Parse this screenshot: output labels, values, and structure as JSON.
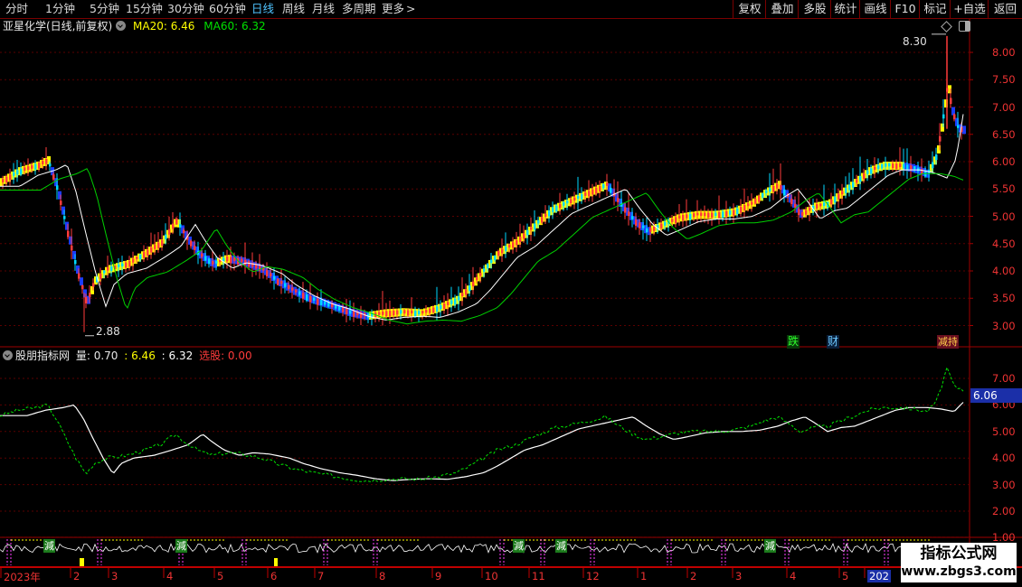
{
  "toolbar": {
    "periods": [
      "分时",
      "1分钟",
      "5分钟",
      "15分钟",
      "30分钟",
      "60分钟",
      "日线",
      "周线",
      "月线",
      "多周期",
      "更多"
    ],
    "active_period": "日线",
    "more_arrow": ">",
    "right_buttons": [
      "复权",
      "叠加",
      "多股",
      "统计",
      "画线",
      "F10",
      "标记",
      "+自选",
      "返回"
    ]
  },
  "main_panel": {
    "stock_title": "亚星化学(日线,前复权)",
    "ma20_label": "MA20: 6.46",
    "ma60_label": "MA60: 6.32",
    "high_marker": "8.30",
    "low_marker": "2.88",
    "y_ticks": [
      "8.00",
      "7.50",
      "7.00",
      "6.50",
      "6.00",
      "5.50",
      "5.00",
      "4.50",
      "4.00",
      "3.50",
      "3.00"
    ],
    "event_tags": [
      "跌",
      "财",
      "减持"
    ],
    "colors": {
      "up_candle": "#ff3b3b",
      "yellow_band": "#ffff00",
      "blue_band": "#1a3cff",
      "ma20": "#ffffff",
      "ma60": "#00d000"
    }
  },
  "indicator_panel": {
    "name": "股朋指标网",
    "vol_label": "量: 0.70",
    "val1": ": 6.46",
    "val2": ": 6.32",
    "select_label": "选股: 0.00",
    "current_value": "6.06",
    "y_ticks": [
      "7.00",
      "6.00",
      "5.00",
      "4.00",
      "3.00",
      "2.00",
      "1.00"
    ]
  },
  "bottom_strip": {
    "tags": [
      "減",
      "減",
      "減",
      "減",
      "減"
    ]
  },
  "x_axis": {
    "labels": [
      "2023年",
      "2",
      "3",
      "4",
      "5",
      "6",
      "7",
      "8",
      "9",
      "10",
      "11",
      "12",
      "1",
      "2",
      "3",
      "4",
      "5",
      "202"
    ]
  },
  "watermark": {
    "line1": "指标公式网",
    "line2": "www.zbgs3.com"
  }
}
